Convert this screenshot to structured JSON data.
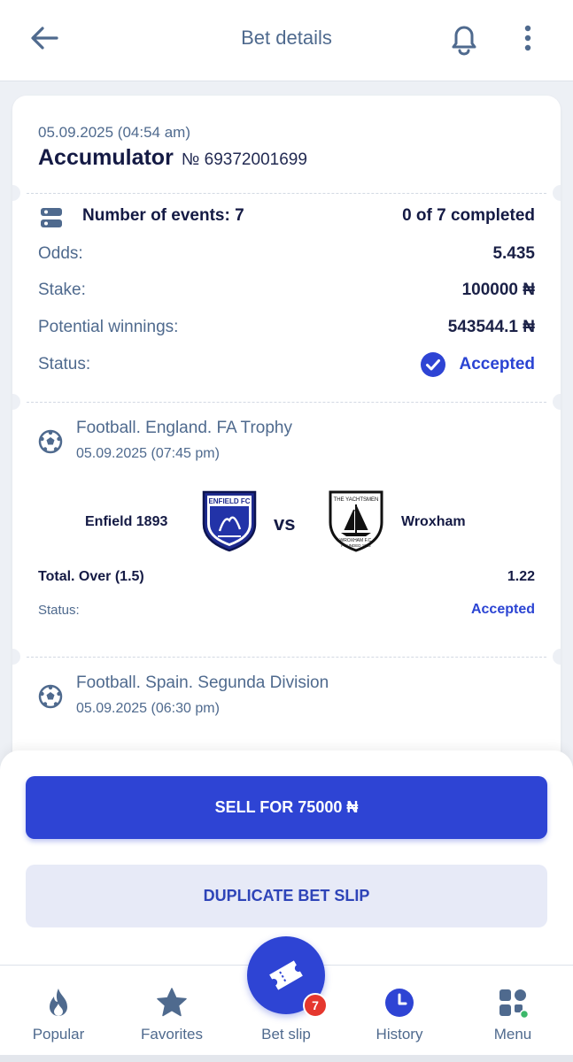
{
  "header": {
    "title": "Bet details"
  },
  "bet": {
    "datetime": "05.09.2025 (04:54 am)",
    "type": "Accumulator",
    "number": "№ 69372001699",
    "events_label": "Number of events: 7",
    "progress": "0 of 7 completed",
    "rows": [
      {
        "label": "Odds:",
        "value": "5.435"
      },
      {
        "label": "Stake:",
        "value": "100000 ₦"
      },
      {
        "label": "Potential winnings:",
        "value": "543544.1 ₦"
      }
    ],
    "status_label": "Status:",
    "status_value": "Accepted"
  },
  "events": [
    {
      "league": "Football. England. FA Trophy",
      "datetime": "05.09.2025 (07:45 pm)",
      "home": "Enfield 1893",
      "away": "Wroxham",
      "vs": "vs",
      "home_crest_text": "ENFIELD FC",
      "away_crest_top": "THE YACHTSMEN",
      "away_crest_mid": "WROXHAM F.C.",
      "away_crest_bottom": "FOUNDED 1892",
      "market": "Total. Over (1.5)",
      "odds": "1.22",
      "status_label": "Status:",
      "status_value": "Accepted"
    },
    {
      "league": "Football. Spain. Segunda Division",
      "datetime": "05.09.2025 (06:30 pm)"
    }
  ],
  "actions": {
    "sell_label": "SELL FOR 75000 ₦",
    "duplicate_label": "DUPLICATE BET SLIP"
  },
  "nav": {
    "items": [
      {
        "label": "Popular",
        "icon": "flame-icon"
      },
      {
        "label": "Favorites",
        "icon": "star-icon"
      },
      {
        "label": "Bet slip",
        "icon": "ticket-icon"
      },
      {
        "label": "History",
        "icon": "clock-icon"
      },
      {
        "label": "Menu",
        "icon": "grid-icon"
      }
    ],
    "betslip_count": "7",
    "active": "History"
  },
  "colors": {
    "accent": "#2e44d4",
    "text_muted": "#4f6a8e",
    "text_dark": "#141a44",
    "badge": "#e5372e"
  }
}
